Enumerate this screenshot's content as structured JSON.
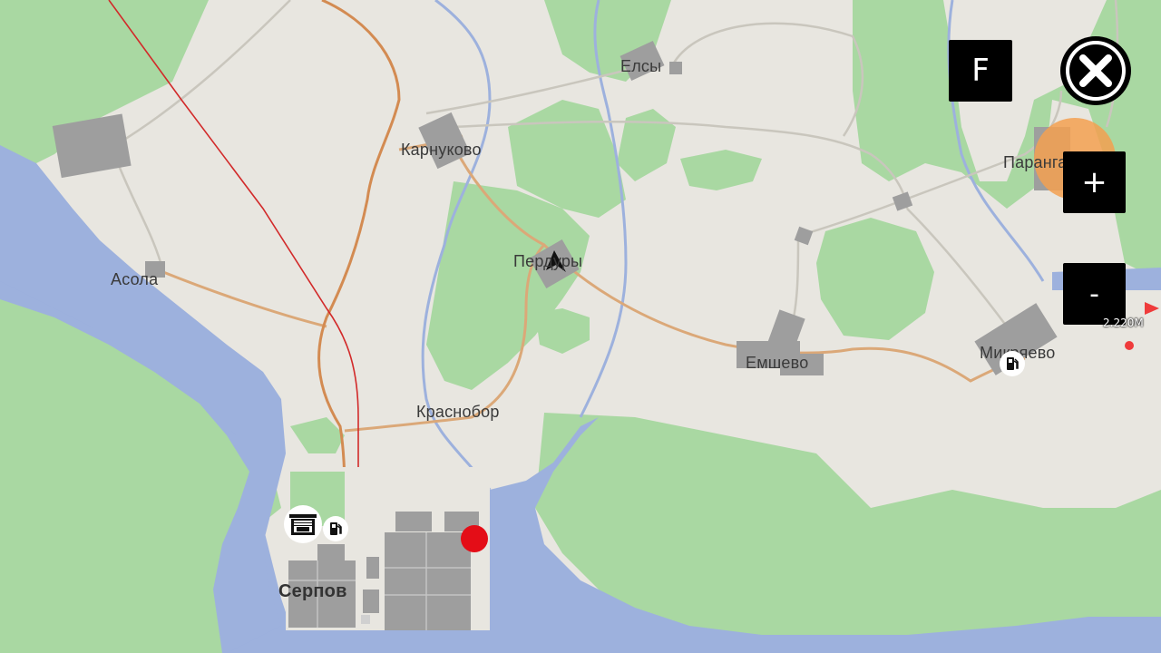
{
  "map": {
    "places": [
      {
        "id": "elsy",
        "name": "Елсы"
      },
      {
        "id": "karnukovo",
        "name": "Карнуково"
      },
      {
        "id": "asola",
        "name": "Асола"
      },
      {
        "id": "perdury",
        "name": "Пердуры"
      },
      {
        "id": "paranga",
        "name": "Паранга"
      },
      {
        "id": "emshevo",
        "name": "Емшево"
      },
      {
        "id": "mikryaevo",
        "name": "Микряево"
      },
      {
        "id": "krasnobor",
        "name": "Краснобор"
      },
      {
        "id": "serpov",
        "name": "Серпов"
      }
    ],
    "colors": {
      "land": "#e8e6e0",
      "forest": "#a8d8a0",
      "water": "#9db0dc",
      "road": "#d9a876",
      "main_road": "#d58a4e",
      "railway": "#d22a2a",
      "buildings": "#9e9e9e"
    },
    "distance": "2.220М"
  },
  "controls": {
    "f_label": "F",
    "zoom_in_label": "+",
    "zoom_out_label": "-"
  },
  "icons": {
    "player": "navigation-arrow-icon",
    "close": "close-icon",
    "garage": "garage-icon",
    "fuel": "fuel-icon",
    "marker": "red-waypoint-marker"
  }
}
